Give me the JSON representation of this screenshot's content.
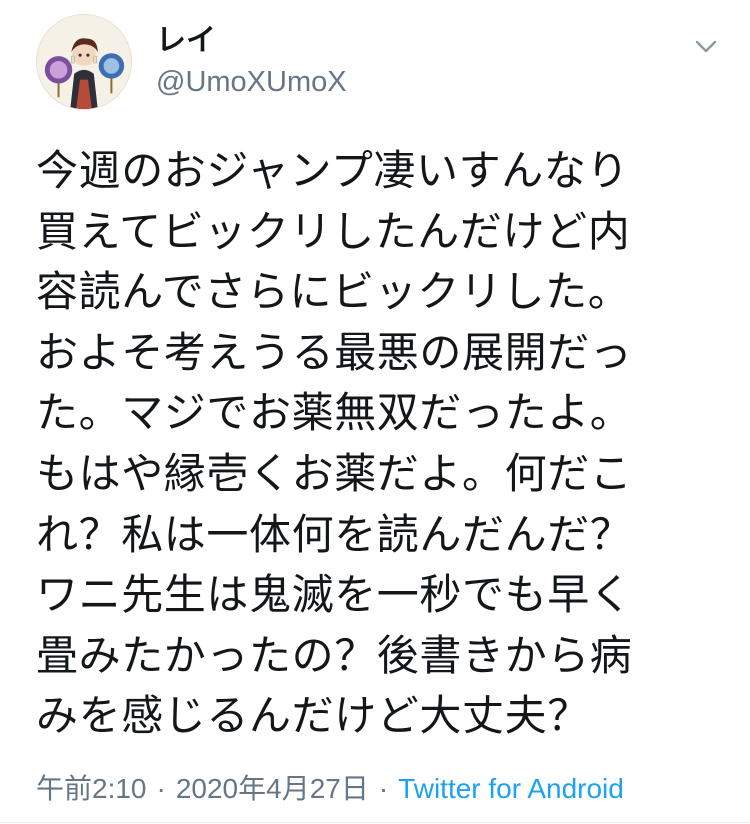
{
  "user": {
    "display_name": "レイ",
    "handle": "@UmoXUmoX"
  },
  "tweet": {
    "lines": [
      "今週のおジャンプ凄いすんなり",
      "買えてビックリしたんだけど内",
      "容読んでさらにビックリした。",
      "およそ考えうる最悪の展開だっ",
      "た。マジでお薬無双だったよ。",
      "もはや縁壱くお薬だよ。何だこ",
      "れ？私は一体何を読んだんだ？",
      "ワニ先生は鬼滅を一秒でも早く",
      "畳みたかったの？後書きから病",
      "みを感じるんだけど大丈夫？"
    ]
  },
  "meta": {
    "time": "午前2:10",
    "separator": "·",
    "date": "2020年4月27日",
    "source": "Twitter for Android"
  },
  "icons": {
    "menu": "chevron-down-icon",
    "avatar": "avatar"
  },
  "colors": {
    "text": "#14171a",
    "secondary": "#657786",
    "link": "#1da1f2"
  }
}
